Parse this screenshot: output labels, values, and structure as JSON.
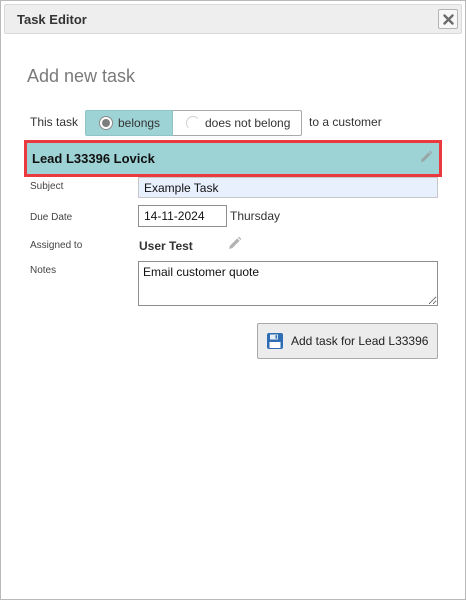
{
  "window": {
    "title": "Task Editor"
  },
  "form": {
    "heading": "Add new task",
    "belong_prefix": "This task",
    "belong_options": [
      "belongs",
      "does not belong"
    ],
    "belong_selected": "belongs",
    "belong_suffix": "to a customer",
    "lead_name": "Lead L33396 Lovick",
    "subject_label": "Subject",
    "subject_value": "Example Task",
    "due_label": "Due Date",
    "due_value": "14-11-2024",
    "due_weekday": "Thursday",
    "assigned_label": "Assigned to",
    "assigned_value": "User Test",
    "notes_label": "Notes",
    "notes_value": "Email customer quote",
    "submit_label": "Add task for Lead L33396"
  },
  "icons": {
    "close": "close-icon",
    "edit": "pencil-icon",
    "save": "floppy-disk-icon"
  },
  "colors": {
    "accent": "#9ed3d6",
    "highlight_border": "#ea3a3f",
    "save_icon": "#2f6db5"
  }
}
